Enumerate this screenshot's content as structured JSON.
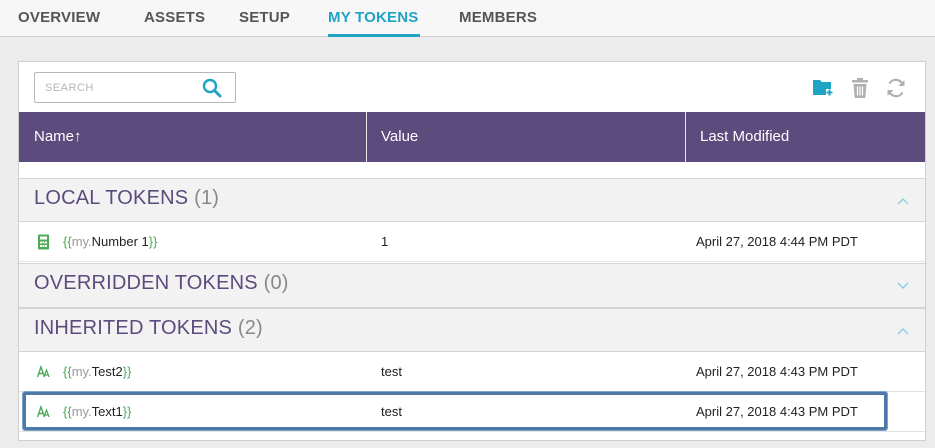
{
  "tabs": [
    {
      "label": "OVERVIEW"
    },
    {
      "label": "ASSETS"
    },
    {
      "label": "SETUP"
    },
    {
      "label": "MY TOKENS",
      "active": true
    },
    {
      "label": "MEMBERS"
    }
  ],
  "search": {
    "placeholder": "SEARCH",
    "value": ""
  },
  "toolbar": {
    "icons": [
      "new-folder-icon",
      "trash-icon",
      "refresh-icon"
    ]
  },
  "table": {
    "columns": [
      "Name↑",
      "Value",
      "Last Modified"
    ]
  },
  "groups": [
    {
      "title": "LOCAL TOKENS",
      "count": "(1)",
      "expanded": true,
      "rows": [
        {
          "icon": "calculator-icon",
          "brace_open": "{{",
          "prefix": "my.",
          "name": "Number 1",
          "brace_close": "}}",
          "value": "1",
          "modified": "April 27, 2018 4:44 PM PDT"
        }
      ]
    },
    {
      "title": "OVERRIDDEN TOKENS",
      "count": "(0)",
      "expanded": false,
      "rows": []
    },
    {
      "title": "INHERITED TOKENS",
      "count": "(2)",
      "expanded": true,
      "rows": [
        {
          "icon": "text-icon",
          "brace_open": "{{",
          "prefix": "my.",
          "name": "Test2",
          "brace_close": "}}",
          "value": "test",
          "modified": "April 27, 2018 4:43 PM PDT"
        },
        {
          "icon": "text-icon",
          "brace_open": "{{",
          "prefix": "my.",
          "name": "Text1",
          "brace_close": "}}",
          "value": "test",
          "modified": "April 27, 2018 4:43 PM PDT",
          "selected": true
        }
      ]
    }
  ],
  "colors": {
    "accent": "#1fa4c4",
    "header": "#5c4b7d",
    "token_brace": "#4daa57",
    "selection": "#4d79a9"
  }
}
